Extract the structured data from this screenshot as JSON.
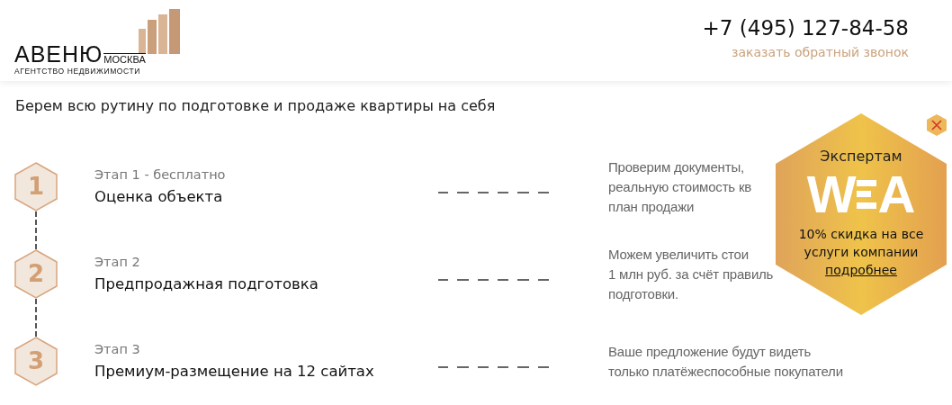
{
  "header": {
    "logo": {
      "name": "АВЕНЮ",
      "city": "МОСКВА",
      "tagline": "АГЕНТСТВО НЕДВИЖИМОСТИ"
    },
    "phone": "+7 (495) 127-84-58",
    "callback_link": "заказать обратный звонок"
  },
  "intro": "Берем всю рутину по подготовке и продаже квартиры на себя",
  "steps": [
    {
      "number": "1",
      "stage": "Этап 1 - бесплатно",
      "title": "Оценка объекта",
      "description": [
        "Проверим документы,",
        "реальную стоимость кв",
        "план продажи"
      ]
    },
    {
      "number": "2",
      "stage": "Этап 2",
      "title": "Предпродажная подготовка",
      "description": [
        "Можем увеличить стои",
        "1 млн руб. за счёт правиль",
        "подготовки."
      ]
    },
    {
      "number": "3",
      "stage": "Этап 3",
      "title": "Премиум-размещение на 12 сайтах",
      "description": [
        "Ваше предложение будут видеть",
        "только платёжеспособные покупатели"
      ]
    }
  ],
  "promo": {
    "heading": "Экспертам",
    "logo_left": "W",
    "logo_right": "A",
    "text": "10% скидка на все услуги компании",
    "link": "подробнее"
  }
}
